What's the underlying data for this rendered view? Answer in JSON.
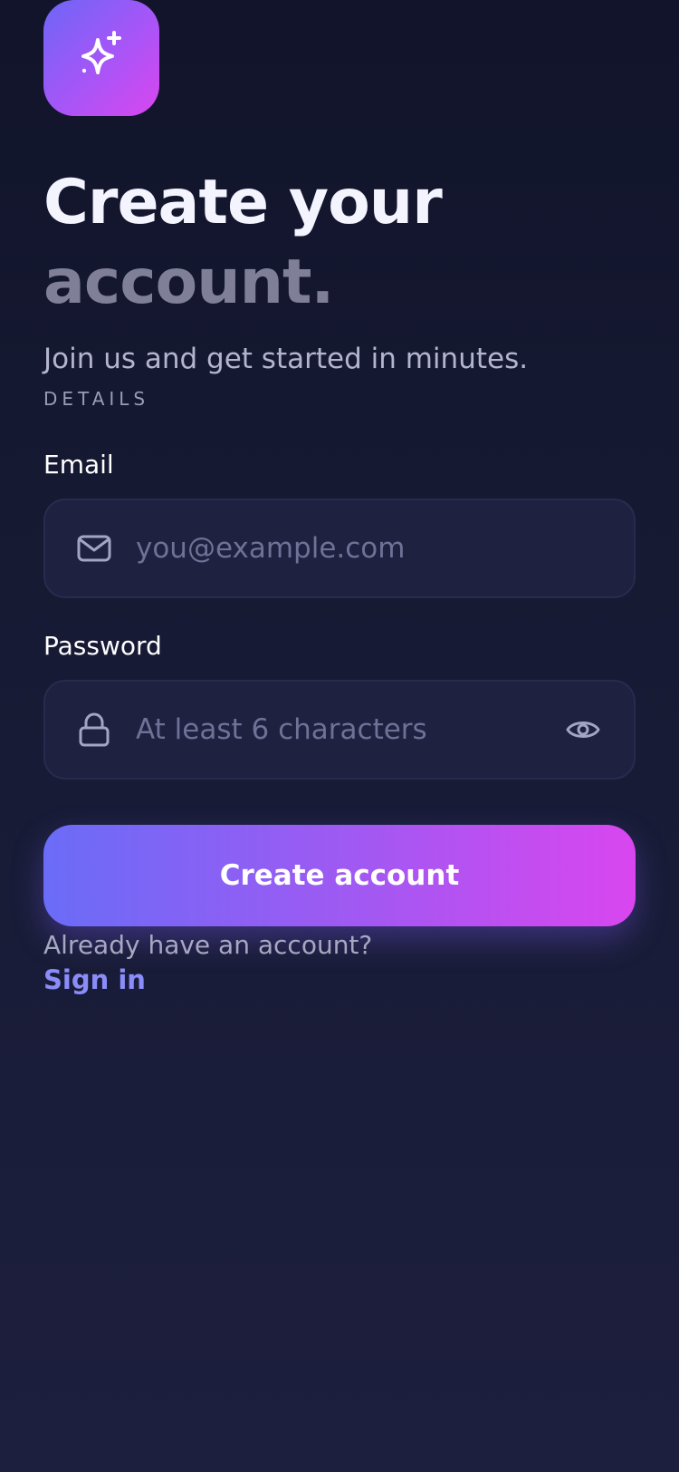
{
  "header": {
    "app_icon": "sparkles-icon",
    "title_line1": "Create your",
    "title_line2": "account.",
    "subtitle": "Join us and get started in minutes.",
    "section_label": "DETAILS"
  },
  "form": {
    "email": {
      "label": "Email",
      "value": "",
      "placeholder": "you@example.com",
      "icon": "mail-icon"
    },
    "password": {
      "label": "Password",
      "value": "",
      "placeholder": "At least 6 characters",
      "icon": "lock-icon",
      "toggle_icon": "eye-icon"
    },
    "submit_label": "Create account"
  },
  "footer": {
    "prompt": "Already have an account?",
    "link_label": "Sign in"
  },
  "colors": {
    "accent_start": "#6a6cf7",
    "accent_end": "#d946ef",
    "link": "#8a8cf9",
    "background": "#161a33"
  }
}
